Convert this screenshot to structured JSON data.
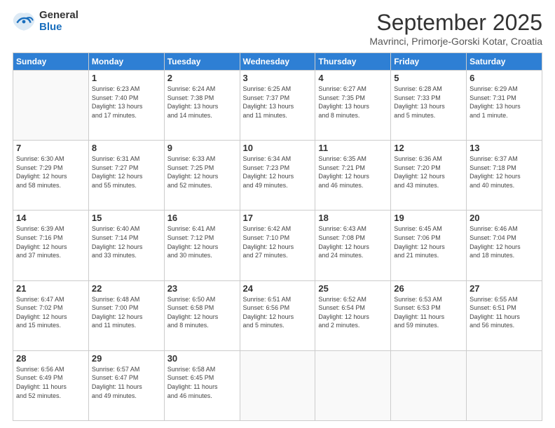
{
  "logo": {
    "general": "General",
    "blue": "Blue"
  },
  "title": "September 2025",
  "location": "Mavrinci, Primorje-Gorski Kotar, Croatia",
  "days_of_week": [
    "Sunday",
    "Monday",
    "Tuesday",
    "Wednesday",
    "Thursday",
    "Friday",
    "Saturday"
  ],
  "weeks": [
    [
      {
        "day": "",
        "info": ""
      },
      {
        "day": "1",
        "info": "Sunrise: 6:23 AM\nSunset: 7:40 PM\nDaylight: 13 hours\nand 17 minutes."
      },
      {
        "day": "2",
        "info": "Sunrise: 6:24 AM\nSunset: 7:38 PM\nDaylight: 13 hours\nand 14 minutes."
      },
      {
        "day": "3",
        "info": "Sunrise: 6:25 AM\nSunset: 7:37 PM\nDaylight: 13 hours\nand 11 minutes."
      },
      {
        "day": "4",
        "info": "Sunrise: 6:27 AM\nSunset: 7:35 PM\nDaylight: 13 hours\nand 8 minutes."
      },
      {
        "day": "5",
        "info": "Sunrise: 6:28 AM\nSunset: 7:33 PM\nDaylight: 13 hours\nand 5 minutes."
      },
      {
        "day": "6",
        "info": "Sunrise: 6:29 AM\nSunset: 7:31 PM\nDaylight: 13 hours\nand 1 minute."
      }
    ],
    [
      {
        "day": "7",
        "info": "Sunrise: 6:30 AM\nSunset: 7:29 PM\nDaylight: 12 hours\nand 58 minutes."
      },
      {
        "day": "8",
        "info": "Sunrise: 6:31 AM\nSunset: 7:27 PM\nDaylight: 12 hours\nand 55 minutes."
      },
      {
        "day": "9",
        "info": "Sunrise: 6:33 AM\nSunset: 7:25 PM\nDaylight: 12 hours\nand 52 minutes."
      },
      {
        "day": "10",
        "info": "Sunrise: 6:34 AM\nSunset: 7:23 PM\nDaylight: 12 hours\nand 49 minutes."
      },
      {
        "day": "11",
        "info": "Sunrise: 6:35 AM\nSunset: 7:21 PM\nDaylight: 12 hours\nand 46 minutes."
      },
      {
        "day": "12",
        "info": "Sunrise: 6:36 AM\nSunset: 7:20 PM\nDaylight: 12 hours\nand 43 minutes."
      },
      {
        "day": "13",
        "info": "Sunrise: 6:37 AM\nSunset: 7:18 PM\nDaylight: 12 hours\nand 40 minutes."
      }
    ],
    [
      {
        "day": "14",
        "info": "Sunrise: 6:39 AM\nSunset: 7:16 PM\nDaylight: 12 hours\nand 37 minutes."
      },
      {
        "day": "15",
        "info": "Sunrise: 6:40 AM\nSunset: 7:14 PM\nDaylight: 12 hours\nand 33 minutes."
      },
      {
        "day": "16",
        "info": "Sunrise: 6:41 AM\nSunset: 7:12 PM\nDaylight: 12 hours\nand 30 minutes."
      },
      {
        "day": "17",
        "info": "Sunrise: 6:42 AM\nSunset: 7:10 PM\nDaylight: 12 hours\nand 27 minutes."
      },
      {
        "day": "18",
        "info": "Sunrise: 6:43 AM\nSunset: 7:08 PM\nDaylight: 12 hours\nand 24 minutes."
      },
      {
        "day": "19",
        "info": "Sunrise: 6:45 AM\nSunset: 7:06 PM\nDaylight: 12 hours\nand 21 minutes."
      },
      {
        "day": "20",
        "info": "Sunrise: 6:46 AM\nSunset: 7:04 PM\nDaylight: 12 hours\nand 18 minutes."
      }
    ],
    [
      {
        "day": "21",
        "info": "Sunrise: 6:47 AM\nSunset: 7:02 PM\nDaylight: 12 hours\nand 15 minutes."
      },
      {
        "day": "22",
        "info": "Sunrise: 6:48 AM\nSunset: 7:00 PM\nDaylight: 12 hours\nand 11 minutes."
      },
      {
        "day": "23",
        "info": "Sunrise: 6:50 AM\nSunset: 6:58 PM\nDaylight: 12 hours\nand 8 minutes."
      },
      {
        "day": "24",
        "info": "Sunrise: 6:51 AM\nSunset: 6:56 PM\nDaylight: 12 hours\nand 5 minutes."
      },
      {
        "day": "25",
        "info": "Sunrise: 6:52 AM\nSunset: 6:54 PM\nDaylight: 12 hours\nand 2 minutes."
      },
      {
        "day": "26",
        "info": "Sunrise: 6:53 AM\nSunset: 6:53 PM\nDaylight: 11 hours\nand 59 minutes."
      },
      {
        "day": "27",
        "info": "Sunrise: 6:55 AM\nSunset: 6:51 PM\nDaylight: 11 hours\nand 56 minutes."
      }
    ],
    [
      {
        "day": "28",
        "info": "Sunrise: 6:56 AM\nSunset: 6:49 PM\nDaylight: 11 hours\nand 52 minutes."
      },
      {
        "day": "29",
        "info": "Sunrise: 6:57 AM\nSunset: 6:47 PM\nDaylight: 11 hours\nand 49 minutes."
      },
      {
        "day": "30",
        "info": "Sunrise: 6:58 AM\nSunset: 6:45 PM\nDaylight: 11 hours\nand 46 minutes."
      },
      {
        "day": "",
        "info": ""
      },
      {
        "day": "",
        "info": ""
      },
      {
        "day": "",
        "info": ""
      },
      {
        "day": "",
        "info": ""
      }
    ]
  ]
}
